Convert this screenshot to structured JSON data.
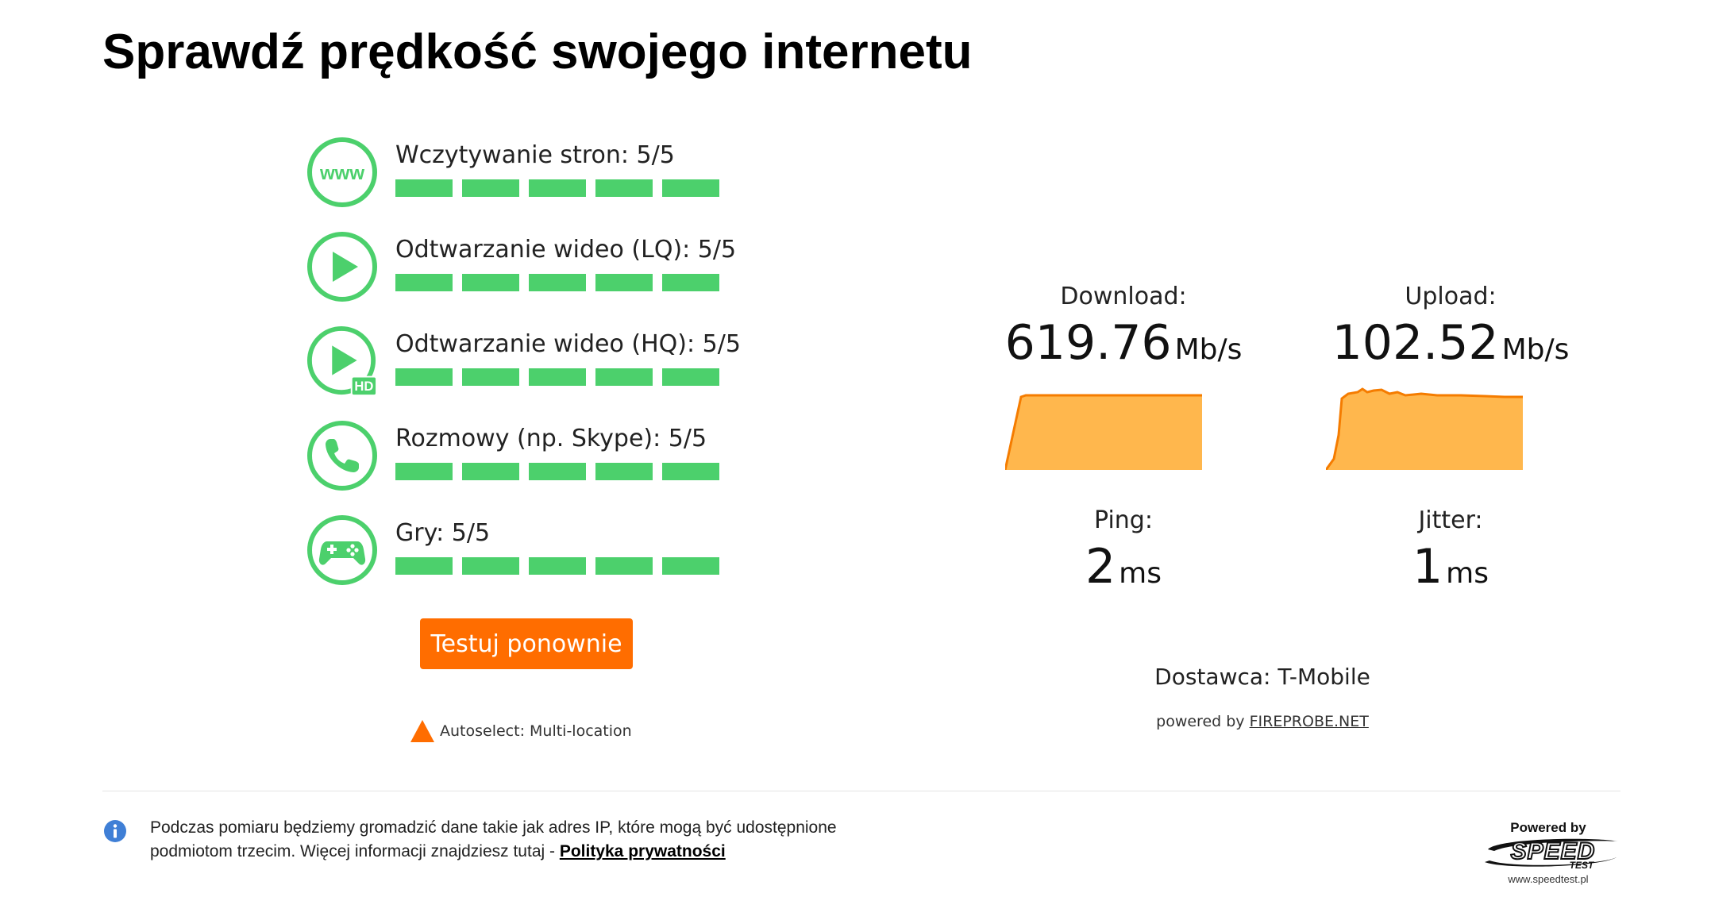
{
  "page": {
    "title": "Sprawdź prędkość swojego internetu"
  },
  "quality": [
    {
      "label": "Wczytywanie stron: 5/5",
      "icon": "www-icon",
      "score": 5,
      "max": 5
    },
    {
      "label": "Odtwarzanie wideo (LQ): 5/5",
      "icon": "play-icon",
      "score": 5,
      "max": 5
    },
    {
      "label": "Odtwarzanie wideo (HQ): 5/5",
      "icon": "play-hd-icon",
      "score": 5,
      "max": 5,
      "badge": "HD"
    },
    {
      "label": "Rozmowy (np. Skype): 5/5",
      "icon": "phone-icon",
      "score": 5,
      "max": 5
    },
    {
      "label": "Gry: 5/5",
      "icon": "gamepad-icon",
      "score": 5,
      "max": 5
    }
  ],
  "icons": {
    "www_text": "www"
  },
  "actions": {
    "retest_label": "Testuj ponownie"
  },
  "server": {
    "label": "Autoselect: Multi-location",
    "icon": "triangle-icon"
  },
  "results": {
    "download": {
      "label": "Download:",
      "value": "619.76",
      "unit": "Mb/s"
    },
    "upload": {
      "label": "Upload:",
      "value": "102.52",
      "unit": "Mb/s"
    },
    "ping": {
      "label": "Ping:",
      "value": "2",
      "unit": "ms"
    },
    "jitter": {
      "label": "Jitter:",
      "value": "1",
      "unit": "ms"
    }
  },
  "provider": {
    "text": "Dostawca: T-Mobile"
  },
  "powered": {
    "prefix": "powered by ",
    "link": "FIREPROBE.NET"
  },
  "footer": {
    "privacy_line1": "Podczas pomiaru będziemy gromadzić dane takie jak adres IP, które mogą być udostępnione",
    "privacy_line2": "podmiotom trzecim. Więcej informacji znajdziesz tutaj - ",
    "privacy_link": "Polityka prywatności",
    "logo_powered": "Powered by",
    "logo_brand": "SPEED",
    "logo_sub": "TEST",
    "logo_url": "www.speedtest.pl"
  },
  "colors": {
    "green": "#4cd06c",
    "orange": "#ff6d00",
    "graph_fill": "#ffb74d",
    "graph_stroke": "#f57c00",
    "info_blue": "#3f7fd6"
  }
}
